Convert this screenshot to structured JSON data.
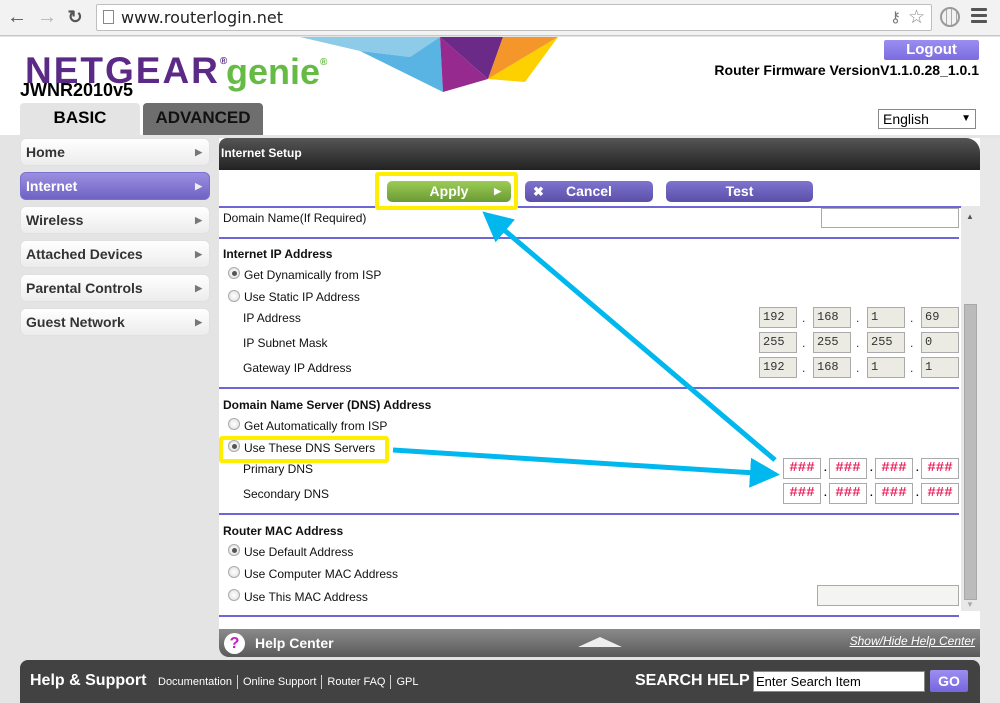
{
  "browser": {
    "url": "www.routerlogin.net",
    "icons": [
      "back-arrow-icon",
      "forward-arrow-icon",
      "reload-icon",
      "page-icon",
      "key-icon",
      "star-icon",
      "globe-icon",
      "menu-icon"
    ]
  },
  "header": {
    "brand": "NETGEAR",
    "product": "genie",
    "registered_mark": "®",
    "model": "JWNR2010v5",
    "logout_label": "Logout",
    "firmware_label": "Router Firmware Version",
    "firmware_version": "V1.1.0.28_1.0.1",
    "language": "English",
    "tabs": [
      {
        "label": "BASIC",
        "active": true
      },
      {
        "label": "ADVANCED",
        "active": false
      }
    ],
    "colors": {
      "brand_purple": "#5b2a86",
      "genie_green": "#66bb44"
    }
  },
  "sidebar": {
    "items": [
      {
        "label": "Home",
        "active": false
      },
      {
        "label": "Internet",
        "active": true
      },
      {
        "label": "Wireless",
        "active": false
      },
      {
        "label": "Attached Devices",
        "active": false
      },
      {
        "label": "Parental Controls",
        "active": false
      },
      {
        "label": "Guest Network",
        "active": false
      }
    ]
  },
  "panel": {
    "title": "Internet Setup",
    "buttons": {
      "apply": "Apply",
      "cancel": "Cancel",
      "test": "Test"
    },
    "domain_name_label": "Domain Name(If Required)",
    "domain_name_value": "",
    "internet_ip": {
      "heading": "Internet IP Address",
      "options": [
        {
          "label": "Get Dynamically from ISP",
          "selected": true
        },
        {
          "label": "Use Static IP Address",
          "selected": false
        }
      ],
      "fields": [
        {
          "label": "IP Address",
          "octets": [
            "192",
            "168",
            "1",
            "69"
          ]
        },
        {
          "label": "IP Subnet Mask",
          "octets": [
            "255",
            "255",
            "255",
            "0"
          ]
        },
        {
          "label": "Gateway IP Address",
          "octets": [
            "192",
            "168",
            "1",
            "1"
          ]
        }
      ]
    },
    "dns": {
      "heading": "Domain Name Server (DNS) Address",
      "options": [
        {
          "label": "Get Automatically from ISP",
          "selected": false
        },
        {
          "label": "Use These DNS Servers",
          "selected": true
        }
      ],
      "fields": [
        {
          "label": "Primary DNS",
          "octets": [
            "###",
            "###",
            "###",
            "###"
          ]
        },
        {
          "label": "Secondary DNS",
          "octets": [
            "###",
            "###",
            "###",
            "###"
          ]
        }
      ]
    },
    "mac": {
      "heading": "Router MAC Address",
      "options": [
        {
          "label": "Use Default Address",
          "selected": true
        },
        {
          "label": "Use Computer MAC Address",
          "selected": false
        },
        {
          "label": "Use This MAC Address",
          "selected": false
        }
      ],
      "mac_value": ""
    },
    "octet_separator": "."
  },
  "help_center": {
    "icon": "?",
    "title": "Help Center",
    "toggle_label": "Show/Hide Help Center"
  },
  "footer": {
    "title": "Help & Support",
    "links": [
      "Documentation",
      "Online Support",
      "Router FAQ",
      "GPL"
    ],
    "search_label": "SEARCH HELP",
    "search_value": "Enter Search Item",
    "go_label": "GO"
  },
  "annotations": {
    "highlight_color": "#ffee00",
    "arrow_color": "#00b8ee",
    "highlighted": [
      "Apply button",
      "Use These DNS Servers option"
    ]
  }
}
